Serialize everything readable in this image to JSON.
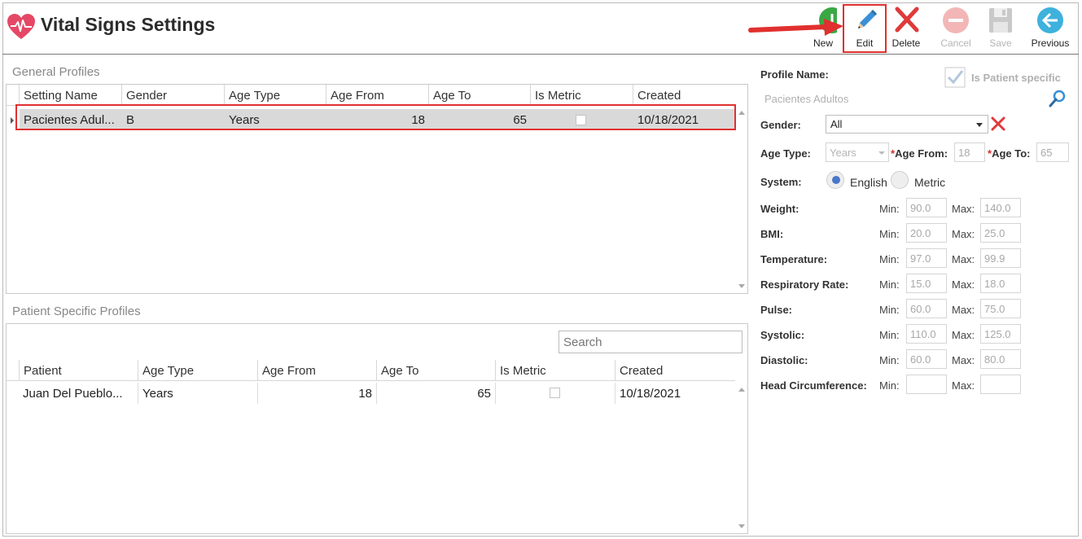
{
  "app": {
    "title": "Vital Signs Settings"
  },
  "toolbar": {
    "new_label": "New",
    "edit_label": "Edit",
    "delete_label": "Delete",
    "cancel_label": "Cancel",
    "save_label": "Save",
    "previous_label": "Previous"
  },
  "general_profiles": {
    "title": "General Profiles",
    "columns": [
      "Setting Name",
      "Gender",
      "Age Type",
      "Age From",
      "Age To",
      "Is Metric",
      "Created"
    ],
    "rows": [
      {
        "setting_name": "Pacientes Adul...",
        "gender": "B",
        "age_type": "Years",
        "age_from": "18",
        "age_to": "65",
        "is_metric": false,
        "created": "10/18/2021"
      }
    ]
  },
  "patient_profiles": {
    "title": "Patient Specific Profiles",
    "search_placeholder": "Search",
    "columns": [
      "Patient",
      "Age Type",
      "Age From",
      "Age To",
      "Is Metric",
      "Created"
    ],
    "rows": [
      {
        "patient": "Juan Del Pueblo...",
        "age_type": "Years",
        "age_from": "18",
        "age_to": "65",
        "is_metric": false,
        "created": "10/18/2021"
      }
    ]
  },
  "form": {
    "profile_name_label": "Profile Name:",
    "profile_name_value": "Pacientes Adultos",
    "is_patient_specific_label": "Is Patient specific",
    "is_patient_specific": true,
    "gender_label": "Gender:",
    "gender_value": "All",
    "age_type_label": "Age Type:",
    "age_type_value": "Years",
    "age_from_label": "Age From:",
    "age_from_value": "18",
    "age_to_label": "Age To:",
    "age_to_value": "65",
    "required_mark": "*",
    "system_label": "System:",
    "system_options": [
      "English",
      "Metric"
    ],
    "system_selected": "English",
    "min_label": "Min:",
    "max_label": "Max:",
    "vitals": [
      {
        "label": "Weight:",
        "min": "90.0",
        "max": "140.0"
      },
      {
        "label": "BMI:",
        "min": "20.0",
        "max": "25.0"
      },
      {
        "label": "Temperature:",
        "min": "97.0",
        "max": "99.9"
      },
      {
        "label": "Respiratory Rate:",
        "min": "15.0",
        "max": "18.0"
      },
      {
        "label": "Pulse:",
        "min": "60.0",
        "max": "75.0"
      },
      {
        "label": "Systolic:",
        "min": "110.0",
        "max": "125.0"
      },
      {
        "label": "Diastolic:",
        "min": "60.0",
        "max": "80.0"
      },
      {
        "label": "Head Circumference:",
        "min": "",
        "max": ""
      }
    ]
  },
  "colors": {
    "highlight": "#e0302f",
    "accent_blue": "#3a8fd6",
    "new_green": "#3aa843",
    "delete_red": "#e03a3a"
  }
}
